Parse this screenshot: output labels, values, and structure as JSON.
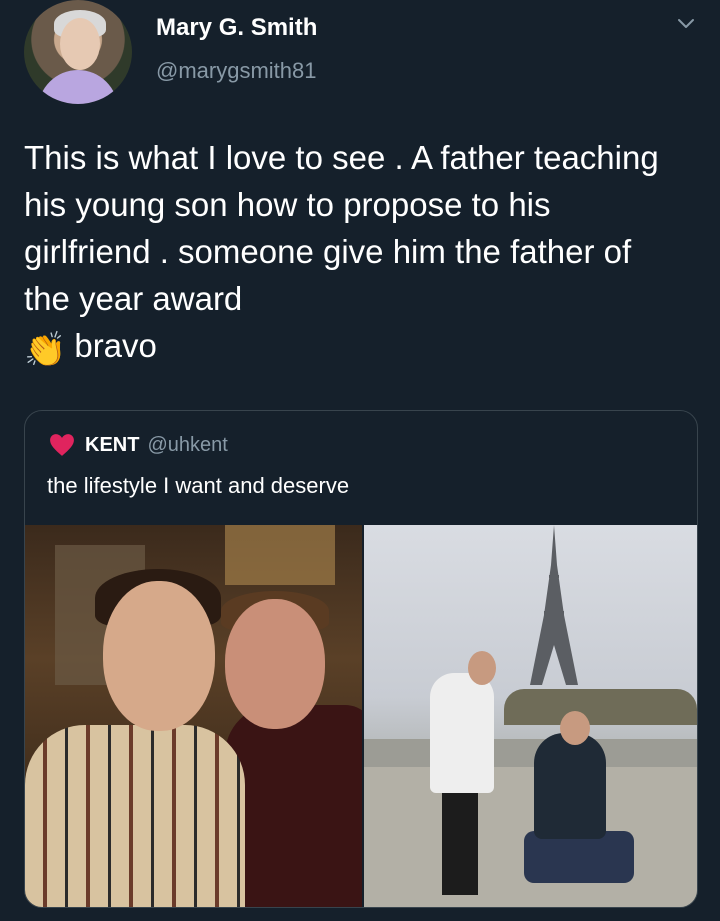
{
  "tweet": {
    "author_name": "Mary G. Smith",
    "author_handle": "@marygsmith81",
    "text_main": "This is what I love to see . A father teaching his young son how to propose to his girlfriend . someone give him the father of the year award",
    "text_emoji": "👏",
    "text_end": "bravo"
  },
  "quoted_tweet": {
    "author_name": "KENT",
    "author_handle": "@uhkent",
    "text": "the lifestyle I want and deserve"
  },
  "icons": {
    "menu": "chevron-down-icon",
    "reaction": "heart-icon"
  },
  "colors": {
    "background": "#15202b",
    "secondary_text": "#8899a6",
    "heart": "#e0245e",
    "border": "#38444d"
  }
}
